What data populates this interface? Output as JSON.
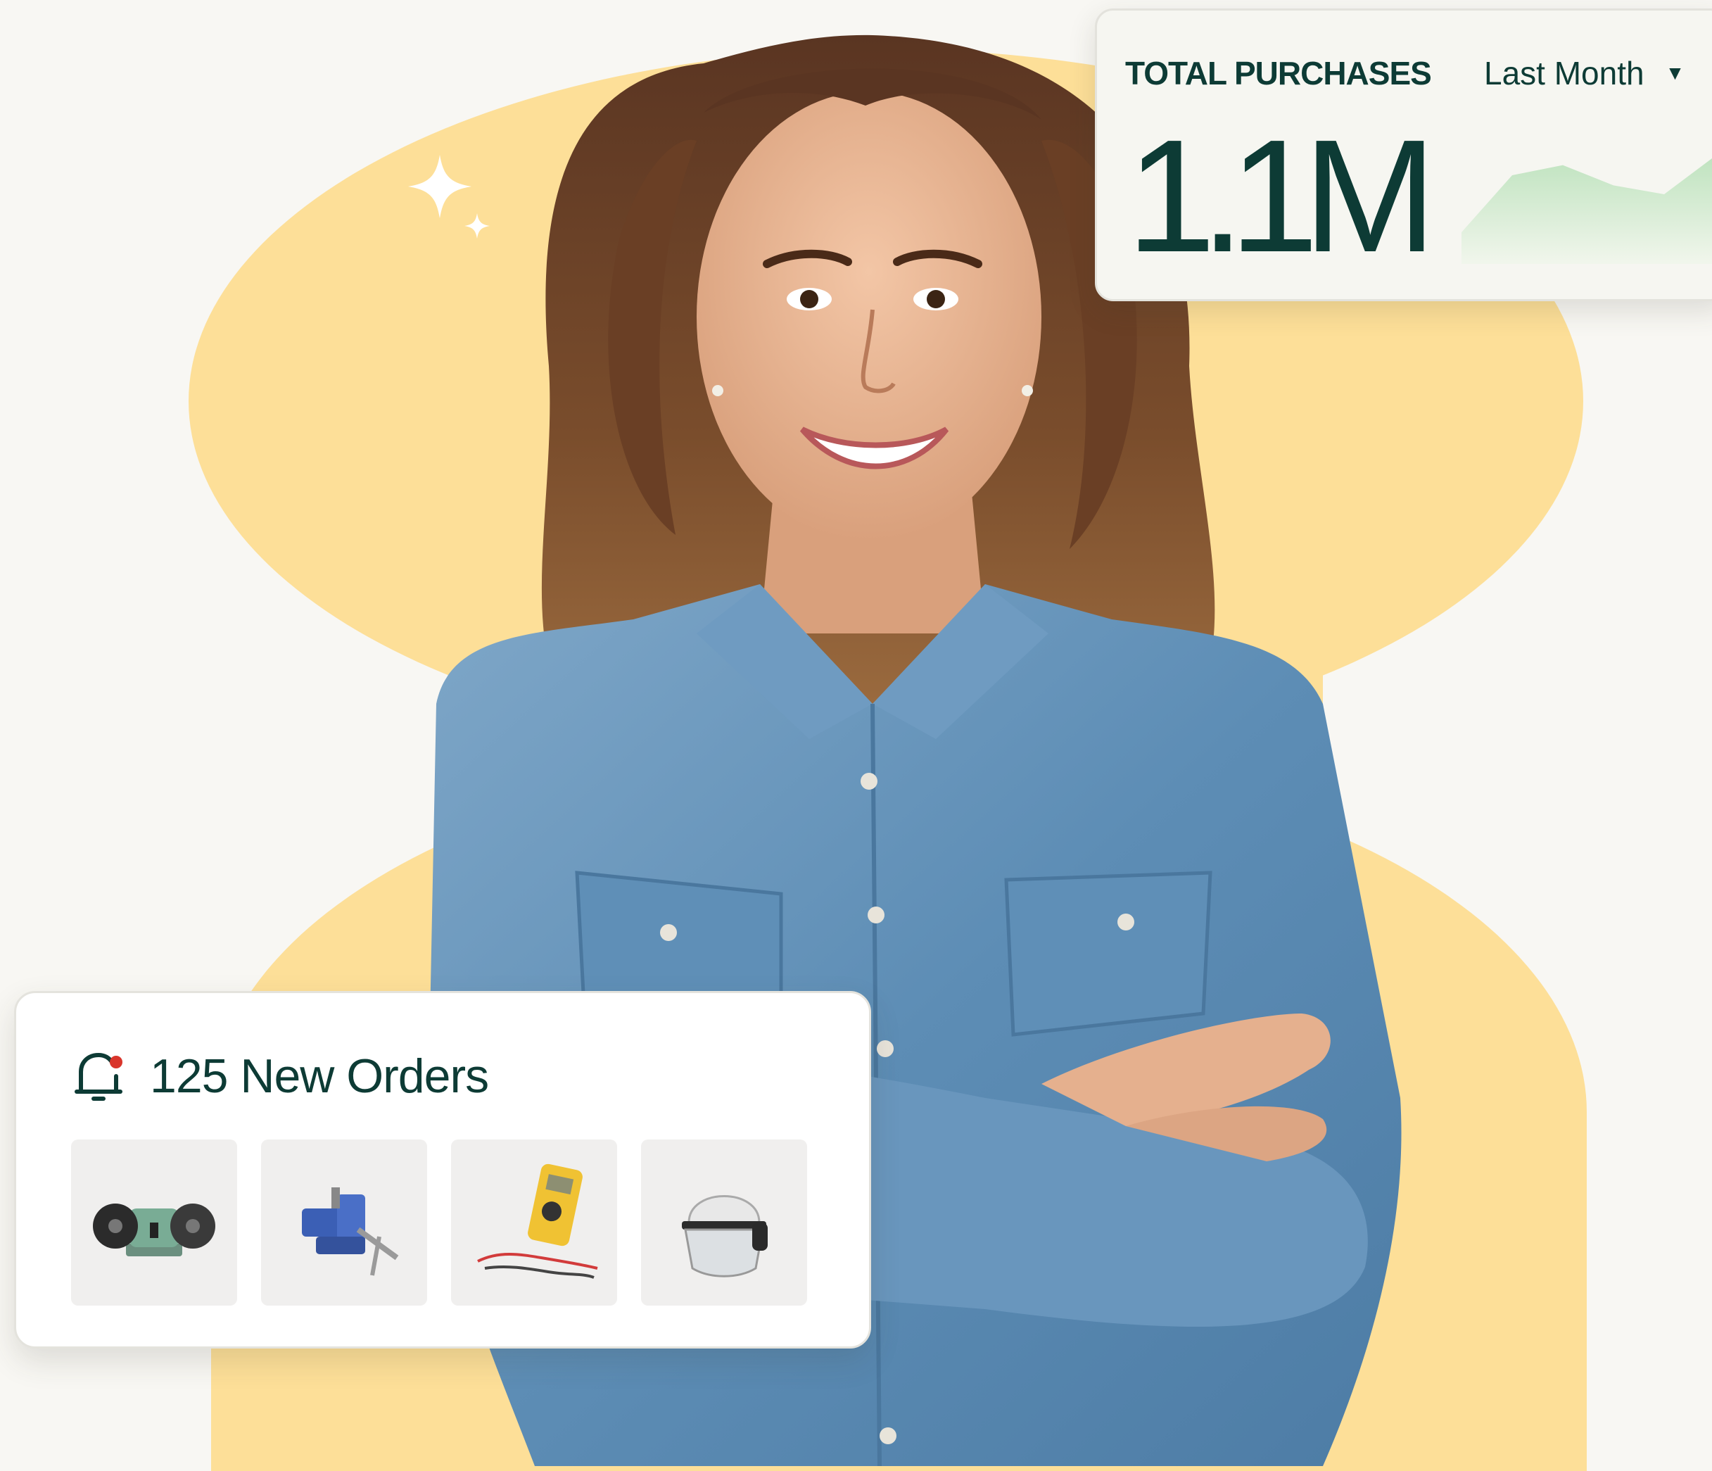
{
  "purchases": {
    "label": "TOTAL PURCHASES",
    "period": "Last Month",
    "value": "1.1M",
    "trend": [
      0.25,
      0.7,
      0.78,
      0.62,
      0.55,
      0.85
    ]
  },
  "orders": {
    "title": "125 New Orders",
    "products": [
      {
        "icon": "bench-grinder-icon"
      },
      {
        "icon": "bench-vise-icon"
      },
      {
        "icon": "multimeter-icon"
      },
      {
        "icon": "safety-helmet-icon"
      }
    ]
  },
  "colors": {
    "brand_dark": "#0d3b35",
    "blob": "#fddf98",
    "background": "#f8f7f3",
    "sparkline": "#bfe3bf",
    "notification_dot": "#d9352b"
  }
}
